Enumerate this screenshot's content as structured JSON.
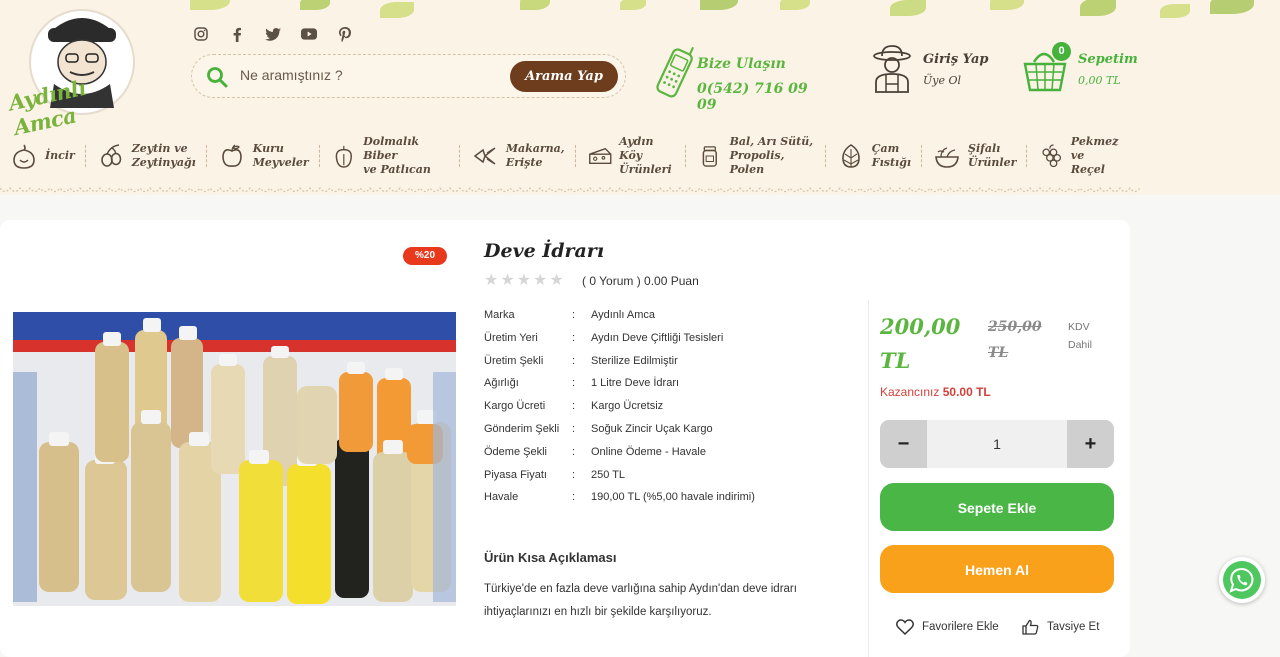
{
  "brand": {
    "logo_text": "Aydınlı Amca"
  },
  "social": [
    "instagram-icon",
    "facebook-icon",
    "twitter-icon",
    "youtube-icon",
    "pinterest-icon"
  ],
  "search": {
    "placeholder": "Ne aramıştınız ?",
    "button_label": "Arama Yap"
  },
  "contact": {
    "label": "Bize Ulaşın",
    "phone": "0(542) 716 09 09"
  },
  "account": {
    "login_label": "Giriş Yap",
    "register_label": "Üye Ol"
  },
  "cart": {
    "count": "0",
    "label": "Sepetim",
    "total": "0,00 TL"
  },
  "nav": [
    {
      "label": "İncir",
      "icon": "fig-icon"
    },
    {
      "label": "Zeytin ve\nZeytinyağı",
      "icon": "olive-icon"
    },
    {
      "label": "Kuru\nMeyveler",
      "icon": "apple-icon"
    },
    {
      "label": "Dolmalık Biber\nve Patlıcan",
      "icon": "pepper-icon"
    },
    {
      "label": "Makarna,\nErişte",
      "icon": "pasta-icon"
    },
    {
      "label": "Aydın Köy\nÜrünleri",
      "icon": "cheese-icon"
    },
    {
      "label": "Bal, Arı Sütü,\nPropolis, Polen",
      "icon": "honey-icon"
    },
    {
      "label": "Çam\nFıstığı",
      "icon": "pinecone-icon"
    },
    {
      "label": "Şifalı\nÜrünler",
      "icon": "herbal-bowl-icon"
    },
    {
      "label": "Pekmez ve\nReçel",
      "icon": "grape-icon"
    }
  ],
  "product": {
    "discount_badge": "%20",
    "title": "Deve İdrarı",
    "review_text": "( 0 Yorum ) 0.00 Puan",
    "specs": [
      {
        "key": "Marka",
        "value": "Aydınlı Amca"
      },
      {
        "key": "Üretim Yeri",
        "value": "Aydın Deve Çiftliği Tesisleri"
      },
      {
        "key": "Üretim Şekli",
        "value": "Sterilize Edilmiştir"
      },
      {
        "key": "Ağırlığı",
        "value": "1 Litre Deve İdrarı"
      },
      {
        "key": "Kargo Ücreti",
        "value": "Kargo Ücretsiz"
      },
      {
        "key": "Gönderim Şekli",
        "value": "Soğuk Zincir Uçak Kargo"
      },
      {
        "key": "Ödeme Şekli",
        "value": "Online Ödeme - Havale"
      },
      {
        "key": "Piyasa Fiyatı",
        "value": "250 TL"
      },
      {
        "key": "Havale",
        "value": "190,00 TL (%5,00 havale indirimi)"
      }
    ],
    "spec_separator": ":",
    "short_desc_title": "Ürün Kısa Açıklaması",
    "short_desc_text": "Türkiye'de en fazla deve varlığına sahip Aydın'dan deve idrarı ihtiyaçlarınızı en hızlı bir şekilde karşılıyoruz.",
    "price": "200,00 TL",
    "old_price": "250,00 TL",
    "tax_note": "KDV Dahil",
    "saving_label": "Kazancınız",
    "saving_value": "50.00 TL",
    "quantity": "1",
    "minus_label": "−",
    "plus_label": "+",
    "add_to_cart_label": "Sepete Ekle",
    "buy_now_label": "Hemen Al",
    "favorite_label": "Favorilere Ekle",
    "recommend_label": "Tavsiye Et"
  },
  "colors": {
    "green": "#49b646",
    "orange": "#f9a11b",
    "brown": "#6e3d1e",
    "red_badge": "#e8391d"
  }
}
